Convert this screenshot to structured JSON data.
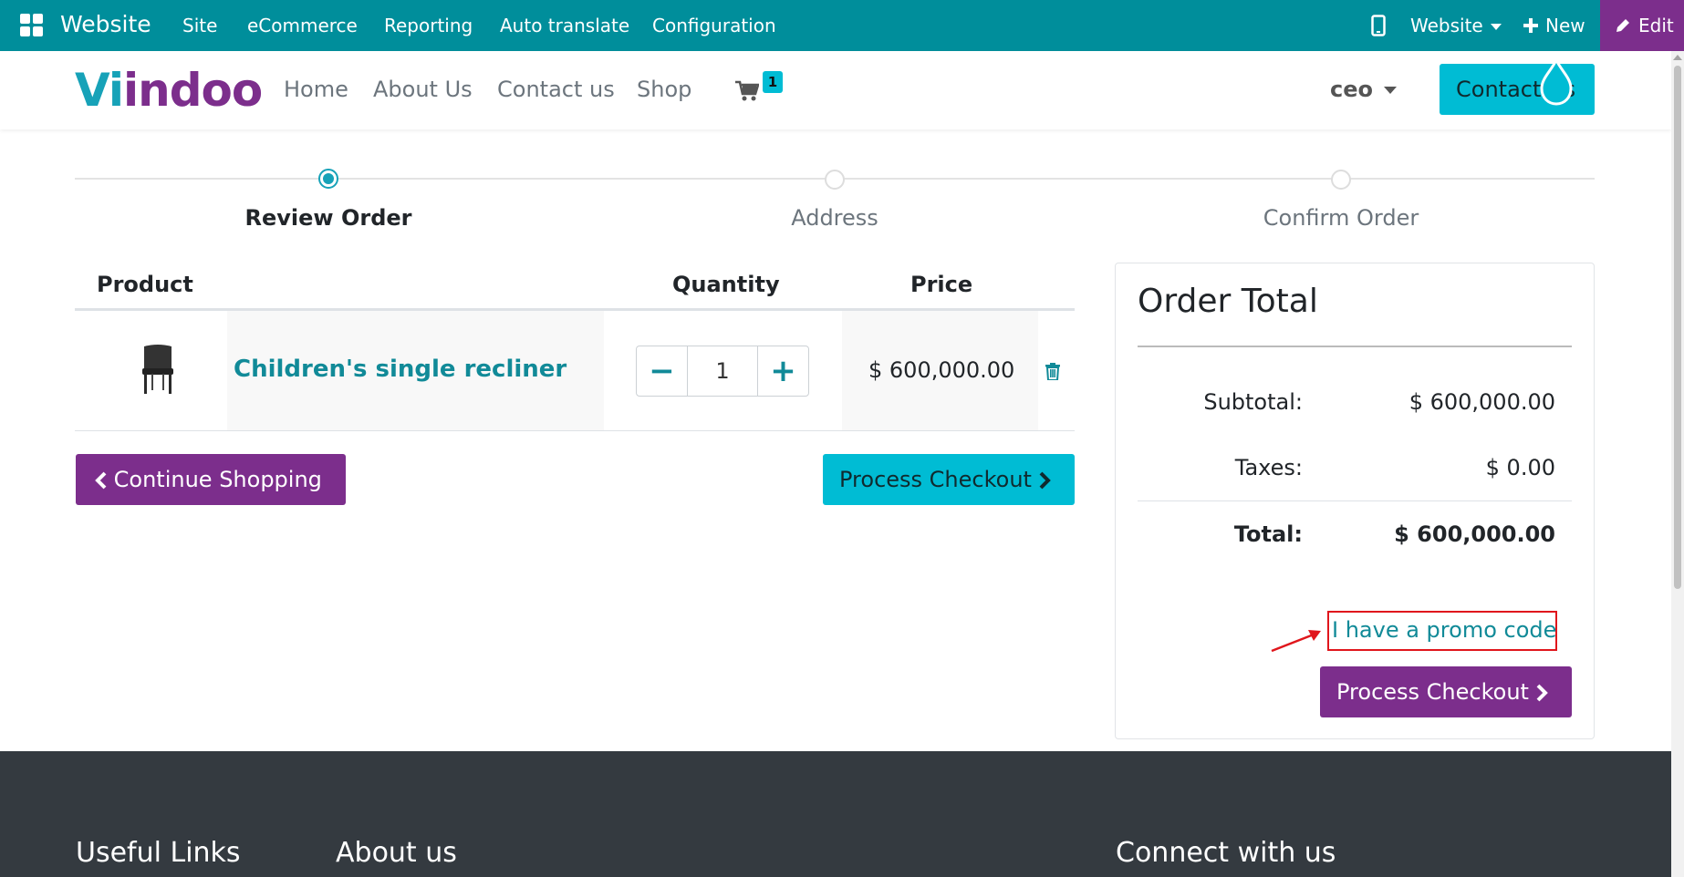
{
  "adminbar": {
    "brand": "Website",
    "menu": [
      "Site",
      "eCommerce",
      "Reporting",
      "Auto translate",
      "Configuration"
    ],
    "website_dropdown": "Website",
    "new_label": "New",
    "edit_label": "Edit"
  },
  "header": {
    "logo_prefix": "Vi",
    "logo_rest": "indoo",
    "nav": [
      "Home",
      "About Us",
      "Contact us",
      "Shop"
    ],
    "cart_count": "1",
    "user": "ceo",
    "contact_button": "Contact Us"
  },
  "steps": [
    {
      "label": "Review Order",
      "active": true
    },
    {
      "label": "Address",
      "active": false
    },
    {
      "label": "Confirm Order",
      "active": false
    }
  ],
  "cart": {
    "headers": {
      "product": "Product",
      "quantity": "Quantity",
      "price": "Price"
    },
    "line": {
      "name": "Children's single recliner",
      "quantity": "1",
      "price": "$ 600,000.00",
      "qty_minus": "−",
      "qty_plus": "+"
    },
    "continue_label": "Continue Shopping",
    "checkout_label": "Process Checkout"
  },
  "order_total": {
    "title": "Order Total",
    "subtotal_label": "Subtotal:",
    "subtotal_value": "$ 600,000.00",
    "taxes_label": "Taxes:",
    "taxes_value": "$ 0.00",
    "total_label": "Total:",
    "total_value": "$ 600,000.00",
    "promo_link": "I have a promo code",
    "checkout_label": "Process Checkout"
  },
  "footer": {
    "headings": [
      "Useful Links",
      "About us",
      "Connect with us"
    ]
  },
  "colors": {
    "adminbar": "#008e9b",
    "brand_purple": "#7c2e8c",
    "brand_cyan": "#00bcd4",
    "link_teal": "#118a98",
    "annotation_red": "#e0161c",
    "footer": "#343a40"
  }
}
